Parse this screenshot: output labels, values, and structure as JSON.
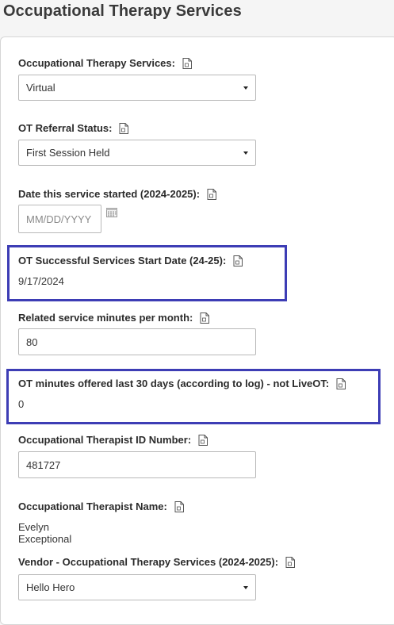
{
  "page": {
    "title": "Occupational Therapy Services"
  },
  "fields": {
    "ot_services": {
      "label": "Occupational Therapy Services:",
      "value": "Virtual"
    },
    "referral_status": {
      "label": "OT Referral Status:",
      "value": "First Session Held"
    },
    "date_started": {
      "label": "Date this service started (2024-2025):",
      "placeholder": "MM/DD/YYYY"
    },
    "successful_start": {
      "label": "OT Successful Services Start Date (24-25):",
      "value": "9/17/2024"
    },
    "related_minutes": {
      "label": "Related service minutes per month:",
      "value": "80"
    },
    "minutes_offered": {
      "label": "OT minutes offered last 30 days (according to log) - not LiveOT:",
      "value": "0"
    },
    "therapist_id": {
      "label": "Occupational Therapist ID Number:",
      "value": "481727"
    },
    "therapist_name": {
      "label": "Occupational Therapist Name:",
      "value": "Evelyn Exceptional"
    },
    "vendor": {
      "label": "Vendor - Occupational Therapy Services (2024-2025):",
      "value": "Hello Hero"
    }
  },
  "icons": {
    "field_info": "document-icon",
    "calendar": "calendar-icon"
  },
  "colors": {
    "highlight": "#3d3db5"
  }
}
